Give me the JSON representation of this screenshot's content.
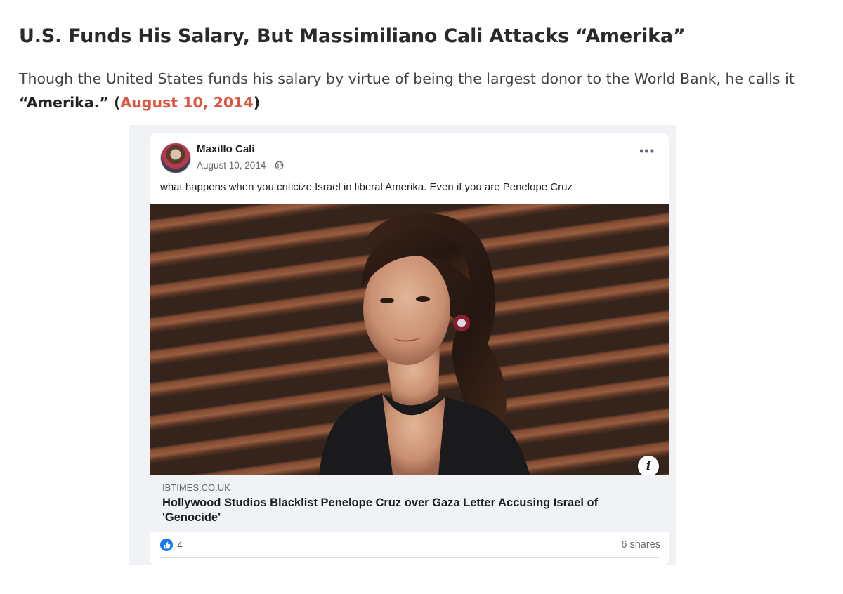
{
  "article": {
    "headline": "U.S. Funds His Salary, But Massimiliano Cali Attacks “Amerika”",
    "lede_text": "Though the United States funds his salary by virtue of being the largest donor to the World Bank, he calls it ",
    "lede_bold": "“Amerika.”",
    "lede_paren_open": " (",
    "lede_date_link": "August 10, 2014",
    "lede_paren_close": ")"
  },
  "colors": {
    "link": "#e0533f",
    "facebook_blue": "#1877f2"
  },
  "post": {
    "author": "Maxillo Calì",
    "date": "August 10, 2014",
    "date_separator": "·",
    "more_label": "•••",
    "caption": "what happens when you criticize Israel in liberal Amerika. Even if you are Penelope Cruz",
    "info_label": "i",
    "link_domain": "IBTIMES.CO.UK",
    "link_title": "Hollywood Studios Blacklist Penelope Cruz over Gaza Letter Accusing Israel of 'Genocide'",
    "reaction_count": "4",
    "shares": "6 shares"
  },
  "icons": {
    "privacy": "globe-icon",
    "reaction": "like-icon",
    "menu": "more-options-icon",
    "info": "info-icon"
  }
}
